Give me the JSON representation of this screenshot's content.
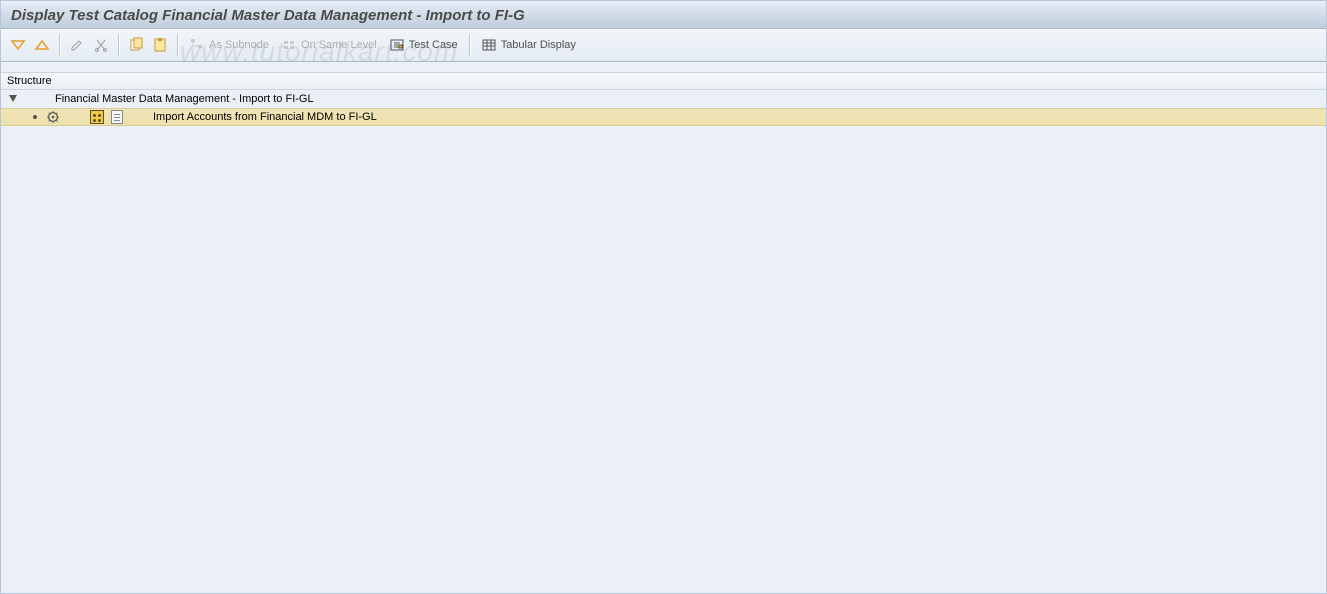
{
  "header": {
    "title": "Display Test Catalog Financial Master Data Management - Import to FI-G"
  },
  "toolbar": {
    "as_subnode": "As Subnode",
    "on_same_level": "On Same Level",
    "test_case": "Test Case",
    "tabular_display": "Tabular Display"
  },
  "structure": {
    "header": "Structure",
    "root": "Financial Master Data Management - Import to FI-GL",
    "child": "Import Accounts from Financial MDM to FI-GL"
  },
  "watermark": "www.tutorialkart.com"
}
